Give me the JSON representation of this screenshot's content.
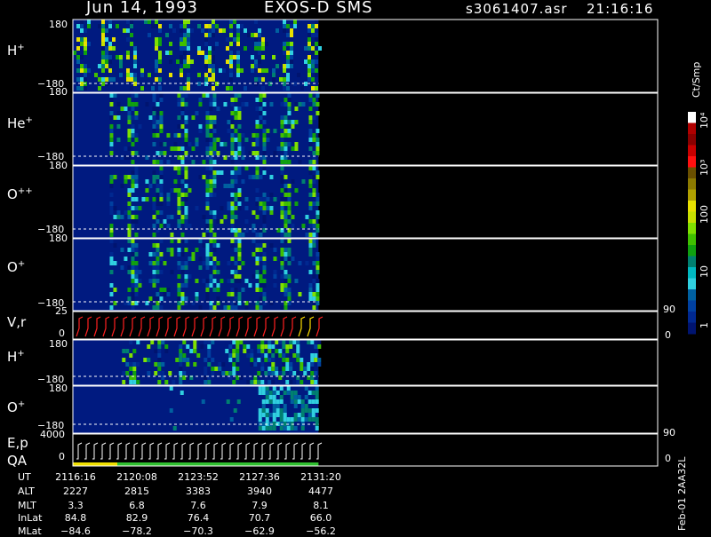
{
  "header": {
    "date": "Jun 14, 1993",
    "mission": "EXOS-D SMS",
    "file": "s3061407.asr",
    "clock": "21:16:16"
  },
  "panels": [
    {
      "key": "h1",
      "label": "H",
      "sup": "+",
      "ymax": "180",
      "ymin": "−180"
    },
    {
      "key": "he",
      "label": "He",
      "sup": "+",
      "ymax": "180",
      "ymin": "−180"
    },
    {
      "key": "opp",
      "label": "O",
      "sup": "++",
      "ymax": "180",
      "ymin": "−180"
    },
    {
      "key": "o1",
      "label": "O",
      "sup": "+",
      "ymax": "180",
      "ymin": "−180"
    },
    {
      "key": "vr",
      "label": "V,r",
      "sup": "",
      "ymax": "25",
      "ymin": "0",
      "right_top": "90",
      "right_bottom": "0"
    },
    {
      "key": "h2",
      "label": "H",
      "sup": "+",
      "ymax": "180",
      "ymin": "−180"
    },
    {
      "key": "o2",
      "label": "O",
      "sup": "+",
      "ymax": "180",
      "ymin": "−180"
    },
    {
      "key": "ep",
      "label": "E,p",
      "sup": "",
      "label2": "QA",
      "ymax": "4000",
      "ymin": "0",
      "right_top": "90",
      "right_bottom": "0"
    }
  ],
  "colorbar": {
    "unit": "Ct/Smp",
    "tick_labels": [
      "10⁴",
      "10³",
      "100",
      "10",
      "1"
    ],
    "colors": [
      "#ffffff",
      "#b00000",
      "#8a0000",
      "#c80000",
      "#ff1010",
      "#6a5000",
      "#8c7a00",
      "#b0a000",
      "#e8e000",
      "#c8e000",
      "#80e000",
      "#40c000",
      "#10a010",
      "#008070",
      "#00b8c0",
      "#30d0e0",
      "#0060a0",
      "#0040a0",
      "#002890",
      "#001470"
    ],
    "values": [
      10000,
      1000,
      100,
      10,
      1
    ]
  },
  "axis_footer": {
    "rows": [
      {
        "name": "UT",
        "values": [
          "2116:16",
          "2120:08",
          "2123:52",
          "2127:36",
          "2131:20"
        ]
      },
      {
        "name": "ALT",
        "values": [
          "2227",
          "2815",
          "3383",
          "3940",
          "4477"
        ]
      },
      {
        "name": "MLT",
        "values": [
          "3.3",
          "6.8",
          "7.6",
          "7.9",
          "8.1"
        ]
      },
      {
        "name": "InLat",
        "values": [
          "84.8",
          "82.9",
          "76.4",
          "70.7",
          "66.0"
        ]
      },
      {
        "name": "MLat",
        "values": [
          "−84.6",
          "−78.2",
          "−70.3",
          "−62.9",
          "−56.2"
        ]
      }
    ],
    "side_label": "Feb-01 2AA32L"
  },
  "chart_data": {
    "type": "heatmap",
    "title": "Jun 14, 1993   EXOS-D SMS",
    "time_ticks": [
      "2116:16",
      "2120:08",
      "2123:52",
      "2127:36",
      "2131:20"
    ],
    "ion_panels": [
      "H+",
      "He+",
      "O++",
      "O+",
      "V,r",
      "H+",
      "O+",
      "E,p / QA"
    ],
    "ylim_angle": [
      -180,
      180
    ],
    "ylim_vr": [
      0,
      25
    ],
    "ylim_ep": [
      0,
      4000
    ],
    "colorbar_range": [
      1,
      10000
    ],
    "data_end_fraction": 0.42
  }
}
